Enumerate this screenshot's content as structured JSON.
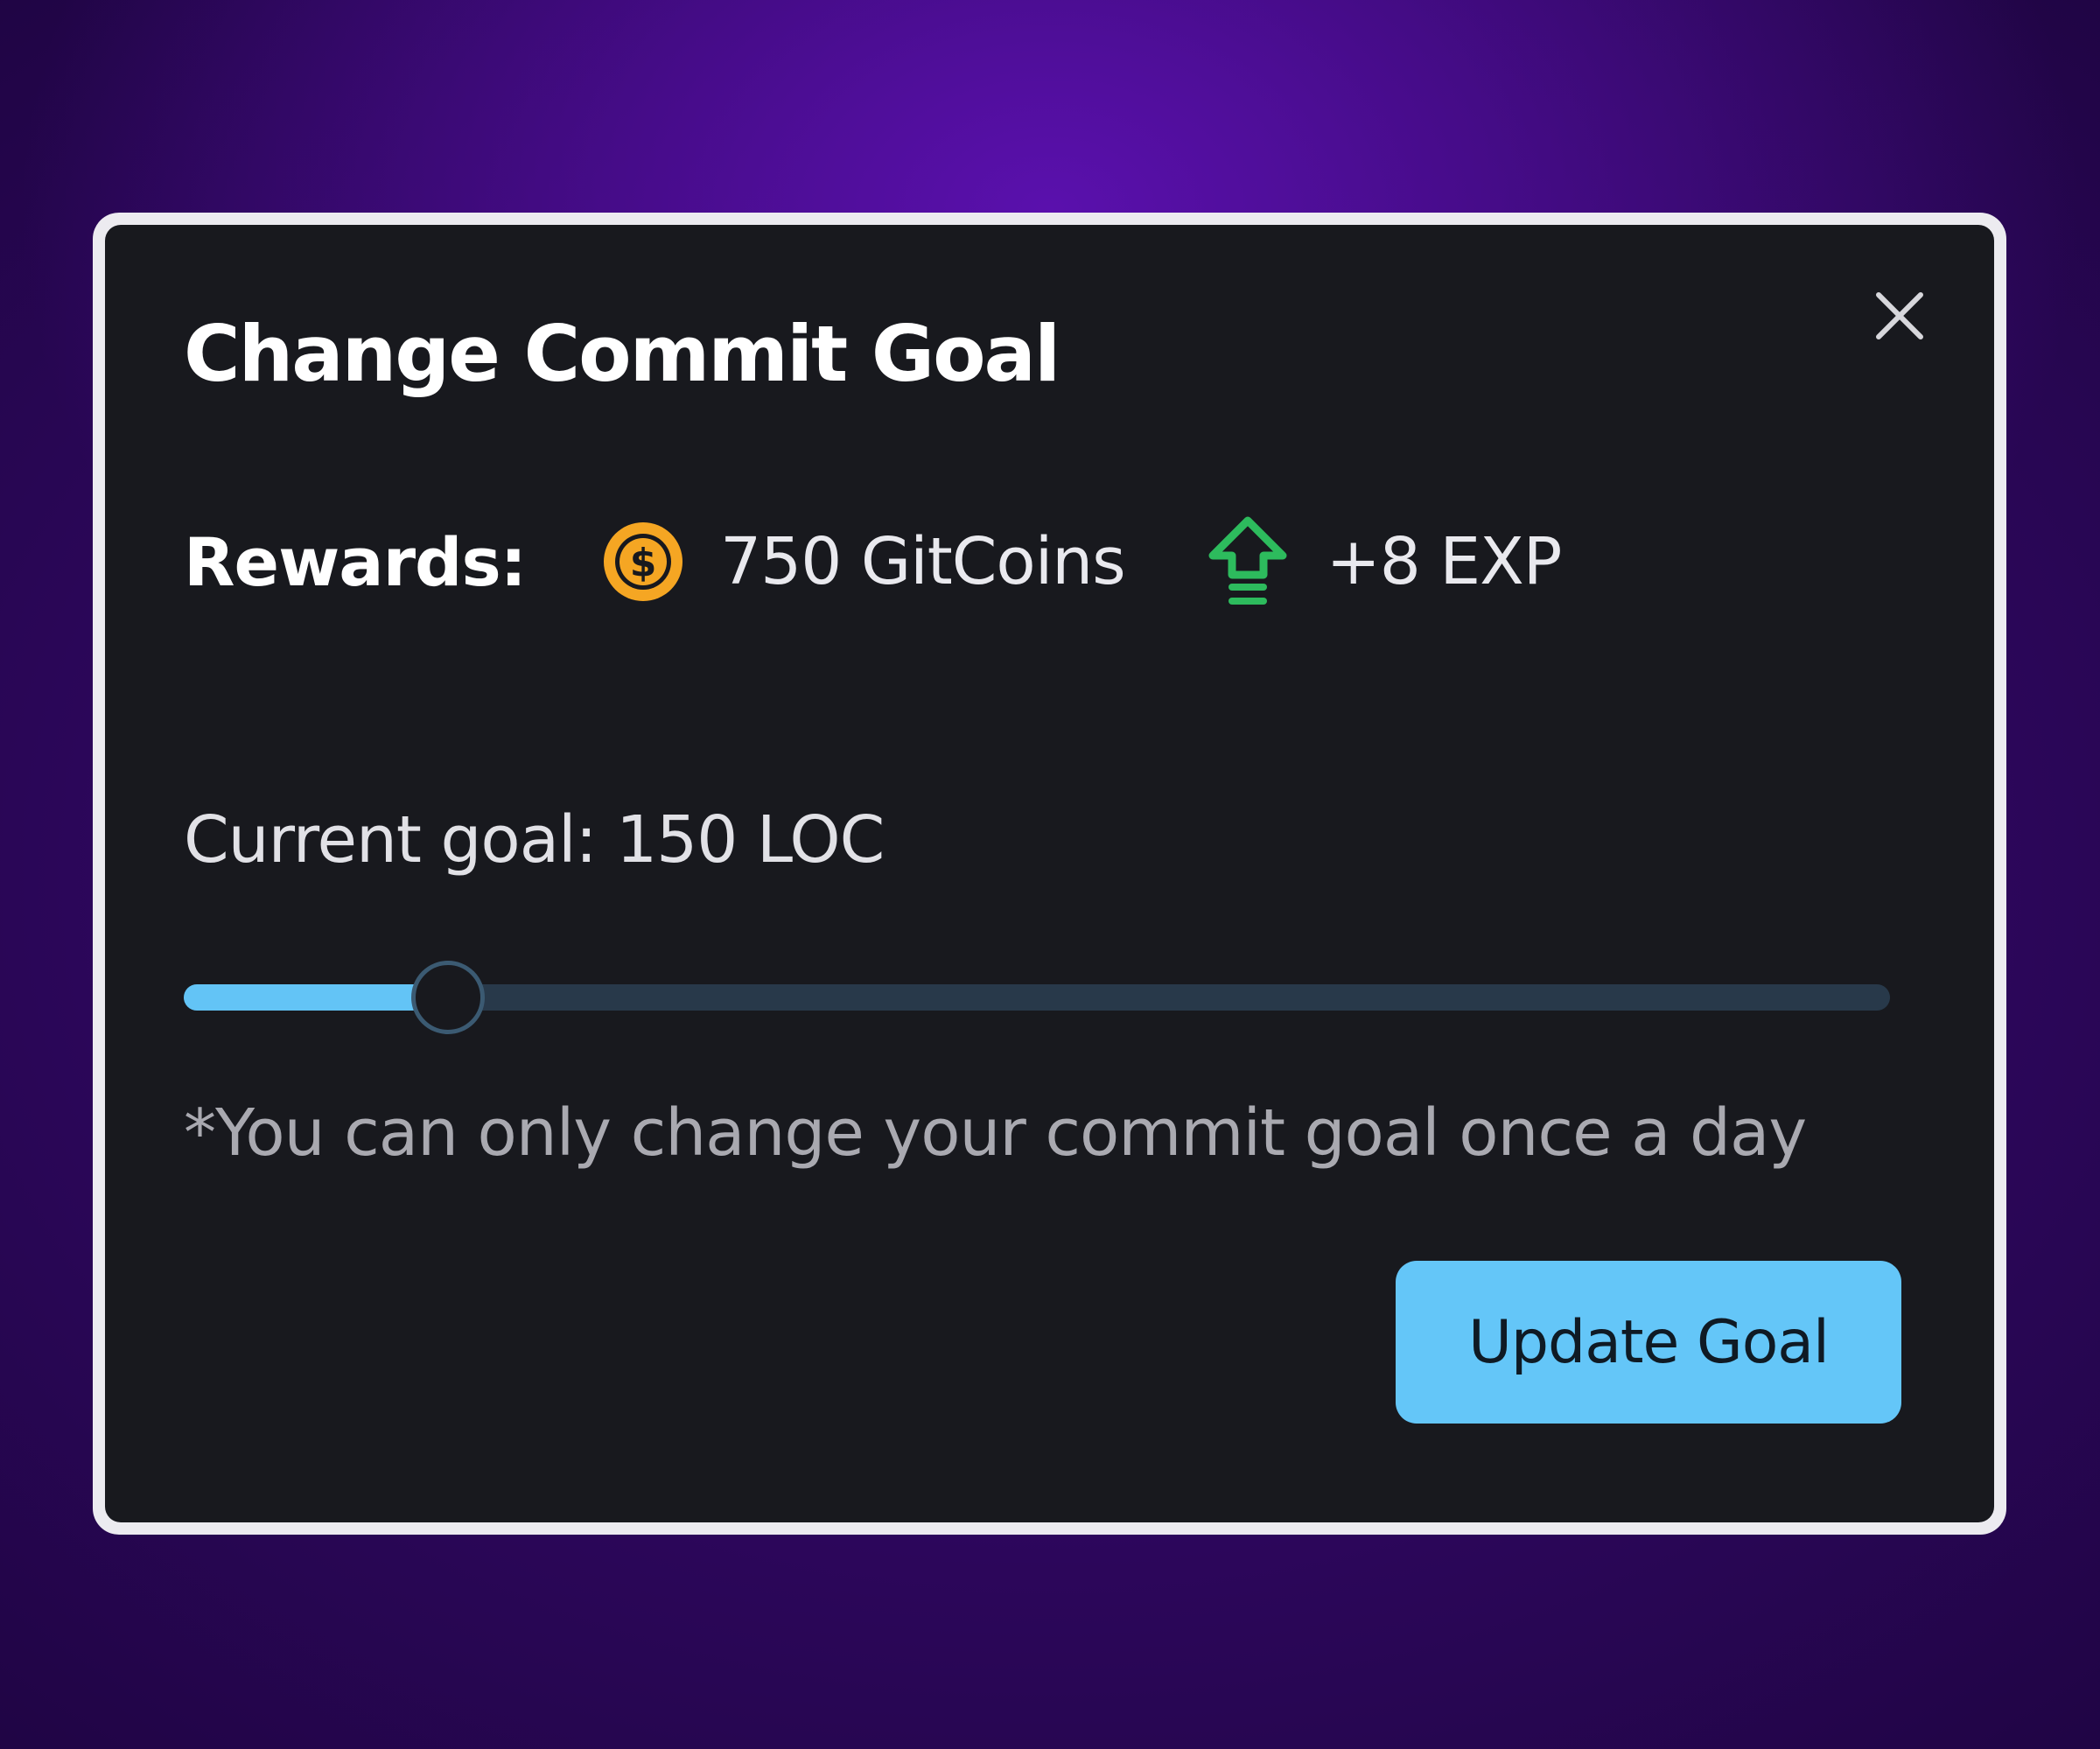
{
  "modal": {
    "title": "Change Commit Goal",
    "close_icon": "close-icon"
  },
  "rewards": {
    "label": "Rewards:",
    "coins": {
      "icon": "coin-icon",
      "value": "750 GitCoins",
      "color": "#f5a623"
    },
    "exp": {
      "icon": "exp-arrow-icon",
      "value": "+8 EXP",
      "color": "#2dbb5d"
    }
  },
  "goal": {
    "current_text": "Current goal: 150 LOC",
    "slider_fraction": 0.155
  },
  "note": "*You can only change your commit goal once a day",
  "actions": {
    "update_label": "Update Goal"
  },
  "colors": {
    "accent": "#64c6f8",
    "modal_bg": "#18191e"
  }
}
